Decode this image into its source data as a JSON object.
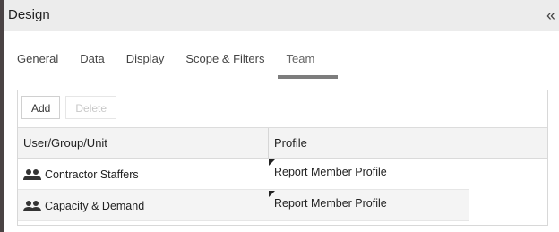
{
  "panel": {
    "title": "Design",
    "collapse_glyph": "«"
  },
  "tabs": [
    {
      "label": "General",
      "active": false
    },
    {
      "label": "Data",
      "active": false
    },
    {
      "label": "Display",
      "active": false
    },
    {
      "label": "Scope & Filters",
      "active": false
    },
    {
      "label": "Team",
      "active": true
    }
  ],
  "toolbar": {
    "add_label": "Add",
    "delete_label": "Delete",
    "delete_disabled": true
  },
  "table": {
    "columns": [
      "User/Group/Unit",
      "Profile",
      ""
    ],
    "rows": [
      {
        "name": "Contractor Staffers",
        "profile": "Report Member Profile",
        "icon": "group-icon"
      },
      {
        "name": "Capacity & Demand",
        "profile": "Report Member Profile",
        "icon": "group-icon"
      }
    ]
  },
  "colors": {
    "header_bg": "#ececec",
    "active_tab_underline": "#7d7d7d",
    "alt_row": "#f4f4f4"
  }
}
